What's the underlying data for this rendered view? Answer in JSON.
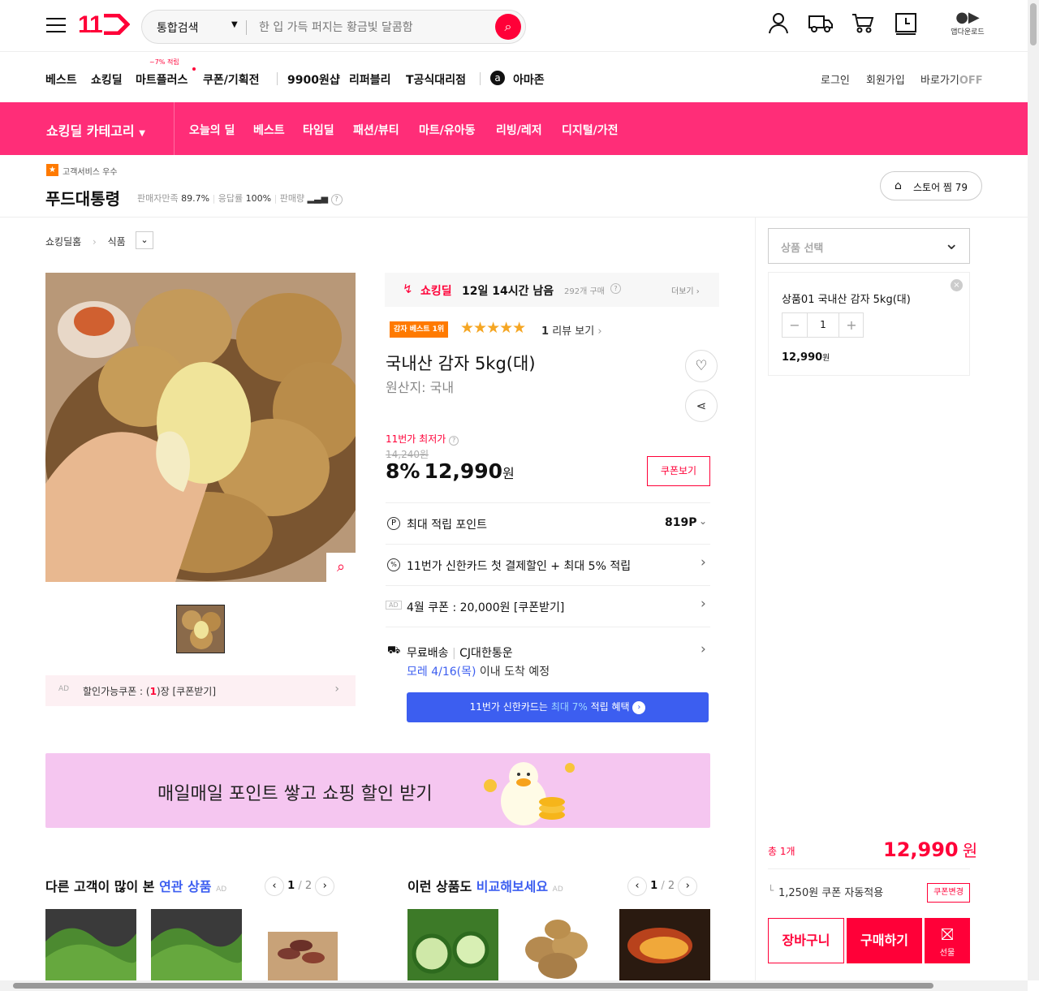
{
  "header": {
    "logo": "11",
    "search_scope": "통합검색",
    "search_placeholder": "한 입 가득 퍼지는 황금빛 달콤함",
    "app_download": "앱다운로드"
  },
  "nav2": {
    "items": [
      "베스트",
      "쇼킹딜",
      "마트플러스",
      "쿠폰/기획전",
      "9900원샵",
      "리퍼블리",
      "T공식대리점",
      "아마존"
    ],
    "mart_badge": "~7% 적립",
    "login": "로그인",
    "signup": "회원가입",
    "shortcut": "바로가기",
    "shortcut_state": "OFF"
  },
  "category_bar": {
    "title": "쇼킹딜 카테고리",
    "items": [
      "오늘의 딜",
      "베스트",
      "타임딜",
      "패션/뷰티",
      "마트/유아동",
      "리빙/레저",
      "디지털/가전"
    ]
  },
  "store": {
    "badge": "고객서비스 우수",
    "name": "푸드대통령",
    "satisfaction_label": "판매자만족",
    "satisfaction": "89.7%",
    "response_label": "응답률",
    "response": "100%",
    "sales_label": "판매량",
    "wish_label": "스토어 찜 79"
  },
  "breadcrumb": {
    "home": "쇼킹딜홈",
    "category": "식품"
  },
  "deal": {
    "label": "쇼킹딜",
    "remaining": "12일 14시간 남음",
    "purchases": "292개 구매",
    "more": "더보기"
  },
  "product": {
    "best_badge": "감자 베스트 1위",
    "rating_stars": 5,
    "review_count": "1",
    "review_label": "리뷰 보기",
    "title": "국내산 감자 5kg(대)",
    "origin": "원산지: 국내",
    "lowest_label": "11번가 최저가",
    "original_price": "14,240원",
    "discount": "8%",
    "price": "12,990",
    "price_unit": "원",
    "coupon_btn": "쿠폰보기"
  },
  "benefits": {
    "point_label": "최대 적립 포인트",
    "point_value": "819P",
    "card_label": "11번가 신한카드 첫 결제할인 + 최대 5% 적립",
    "ad_badge": "AD",
    "coupon_label": "4월 쿠폰 : 20,000원 [쿠폰받기]",
    "shipping_label": "무료배송",
    "carrier": "CJ대한통운",
    "arrival_date": "모레 4/16(목)",
    "arrival_suffix": "이내 도착 예정",
    "card_banner_pre": "11번가 신한카드는",
    "card_banner_hl": "최대 7%",
    "card_banner_post": "적립 혜택"
  },
  "image_coupon": {
    "ad": "AD",
    "pre": "할인가능쿠폰 : (",
    "count": "1",
    "post": ")장 [쿠폰받기]"
  },
  "banner": {
    "text": "매일매일 포인트 쌓고 쇼핑 할인 받기"
  },
  "related": {
    "left_title_pre": "다른 고객이 많이 본",
    "left_title_hl": "연관 상품",
    "left_page": "1",
    "left_total": "2",
    "right_title_pre": "이런 상품도",
    "right_title_hl": "비교해보세요",
    "right_page": "1",
    "right_total": "2",
    "ad": "AD"
  },
  "sidebar": {
    "select_placeholder": "상품 선택",
    "option_name": "상품01 국내산 감자 5kg(대)",
    "qty": "1",
    "option_price": "12,990",
    "won": "원",
    "total_label": "총 1개",
    "total_price": "12,990",
    "total_unit": "원",
    "coupon_applied": "1,250원 쿠폰 자동적용",
    "coupon_change": "쿠폰변경",
    "cart": "장바구니",
    "buy": "구매하기",
    "gift": "선물"
  },
  "colors": {
    "brand": "#ff0038",
    "pink_bar": "#ff2d78",
    "blue": "#3c5ef0",
    "star": "#f5a623"
  }
}
